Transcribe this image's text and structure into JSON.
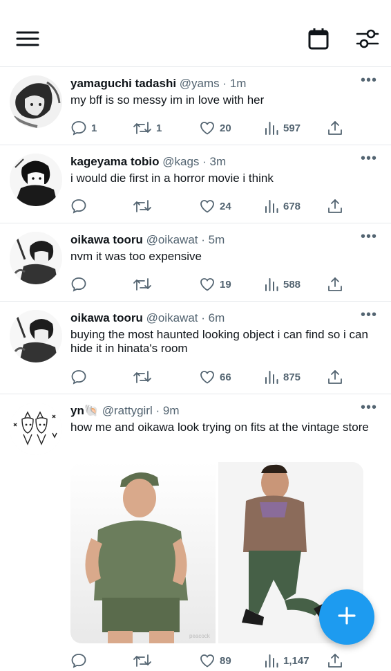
{
  "tweets": [
    {
      "name": "yamaguchi tadashi",
      "handle": "@yams",
      "sep": "·",
      "time": "1m",
      "text": "my bff is so messy im in love with her",
      "replies": "1",
      "retweets": "1",
      "likes": "20",
      "views": "597"
    },
    {
      "name": "kageyama tobio",
      "handle": "@kags",
      "sep": "·",
      "time": "3m",
      "text": "i would die first in a horror movie i think",
      "replies": "",
      "retweets": "",
      "likes": "24",
      "views": "678"
    },
    {
      "name": "oikawa tooru",
      "handle": "@oikawat",
      "sep": "·",
      "time": "5m",
      "text": "nvm it was too expensive",
      "replies": "",
      "retweets": "",
      "likes": "19",
      "views": "588"
    },
    {
      "name": "oikawa tooru",
      "handle": "@oikawat",
      "sep": "·",
      "time": "6m",
      "text": "buying the most haunted looking object i can find so i can hide it in hinata's room",
      "replies": "",
      "retweets": "",
      "likes": "66",
      "views": "875"
    },
    {
      "name": "yn",
      "name_emoji": "🐚",
      "handle": "@rattygirl",
      "sep": "·",
      "time": "9m",
      "text": "how me and oikawa look trying on fits at the vintage store",
      "replies": "",
      "retweets": "",
      "likes": "89",
      "views": "1,147"
    }
  ],
  "media_watermark": "peacock",
  "colors": {
    "accent": "#1d9bf0",
    "muted": "#536471",
    "text": "#0f1419",
    "divider": "#e6e9ec"
  }
}
